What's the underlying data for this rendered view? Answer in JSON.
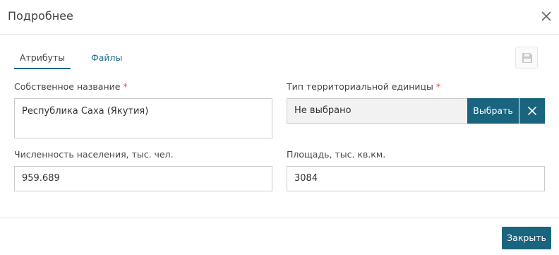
{
  "dialog": {
    "title": "Подробнее",
    "close_icon": "close-icon"
  },
  "tabs": [
    {
      "label": "Атрибуты",
      "active": true
    },
    {
      "label": "Файлы",
      "active": false
    }
  ],
  "toolbar": {
    "save_icon": "floppy-disk-icon"
  },
  "form": {
    "own_name": {
      "label": "Собственное название",
      "required_mark": "*",
      "value": "Республика Саха (Якутия)"
    },
    "territorial_unit_type": {
      "label": "Тип территориальной единицы",
      "required_mark": "*",
      "value": "Не выбрано",
      "choose_label": "Выбрать",
      "clear_icon": "close-icon"
    },
    "population": {
      "label": "Численность населения, тыс. чел.",
      "value": "959.689"
    },
    "area": {
      "label": "Площадь, тыс. кв.км.",
      "value": "3084"
    }
  },
  "footer": {
    "close_label": "Закрыть"
  },
  "colors": {
    "accent": "#19647f",
    "tab_link": "#1e6b8e",
    "required": "#d9534f",
    "readonly_field_bg": "#f2f2f2"
  }
}
